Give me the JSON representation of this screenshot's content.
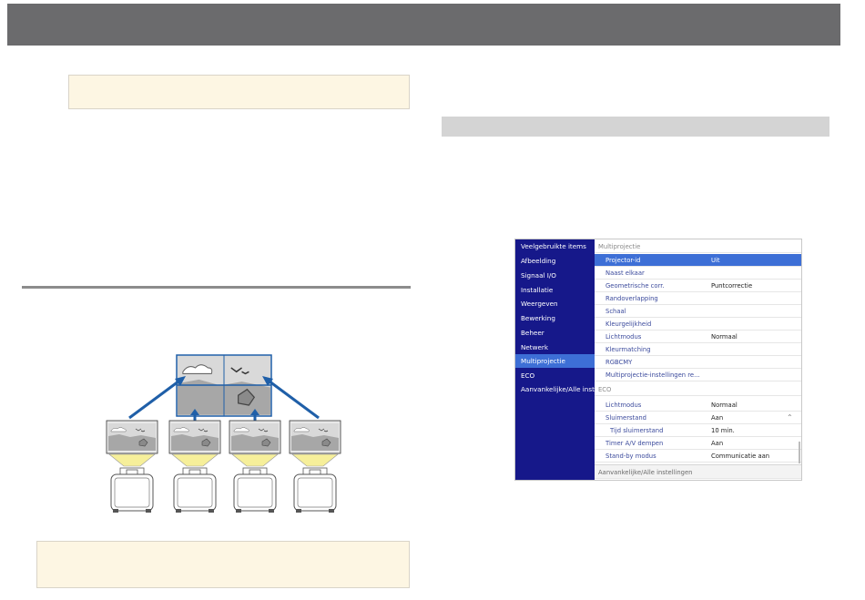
{
  "menu": {
    "sidebar_items": [
      "Veelgebruikte items",
      "Afbeelding",
      "Signaal I/O",
      "Installatie",
      "Weergeven",
      "Bewerking",
      "Beheer",
      "Netwerk",
      "Multiprojectie",
      "ECO",
      "Aanvankelijke/Alle inst..."
    ],
    "selected_sidebar_index": 8,
    "section_multiprojectie": "Multiprojectie",
    "rows_multiprojectie": [
      {
        "label": "Projector-id",
        "value": "Uit"
      },
      {
        "label": "Naast elkaar",
        "value": ""
      },
      {
        "label": "Geometrische corr.",
        "value": "Puntcorrectie"
      },
      {
        "label": "Randoverlapping",
        "value": ""
      },
      {
        "label": "Schaal",
        "value": ""
      },
      {
        "label": "Kleurgelijkheid",
        "value": ""
      },
      {
        "label": "Lichtmodus",
        "value": "Normaal"
      },
      {
        "label": "Kleurmatching",
        "value": ""
      },
      {
        "label": "RGBCMY",
        "value": ""
      },
      {
        "label": "Multiprojectie-instellingen re...",
        "value": ""
      }
    ],
    "section_eco": "ECO",
    "rows_eco": [
      {
        "label": "Lichtmodus",
        "value": "Normaal"
      },
      {
        "label": "Sluimerstand",
        "value": "Aan"
      },
      {
        "label": "Tijd sluimerstand",
        "value": "10 min."
      },
      {
        "label": "Timer A/V dempen",
        "value": "Aan"
      },
      {
        "label": "Stand-by modus",
        "value": "Communicatie aan"
      }
    ],
    "footer_label": "Aanvankelijke/Alle instellingen",
    "chevron_icon": "chevron-up-icon"
  },
  "colors": {
    "sidebar_bg": "#16188a",
    "highlight": "#3d6fd6",
    "note_bg": "#fdf6e3",
    "top_bar": "#6b6b6d",
    "screen_border": "#1f5fa8",
    "arrow": "#1f5fa8",
    "light_beam": "#f6ef9a"
  }
}
